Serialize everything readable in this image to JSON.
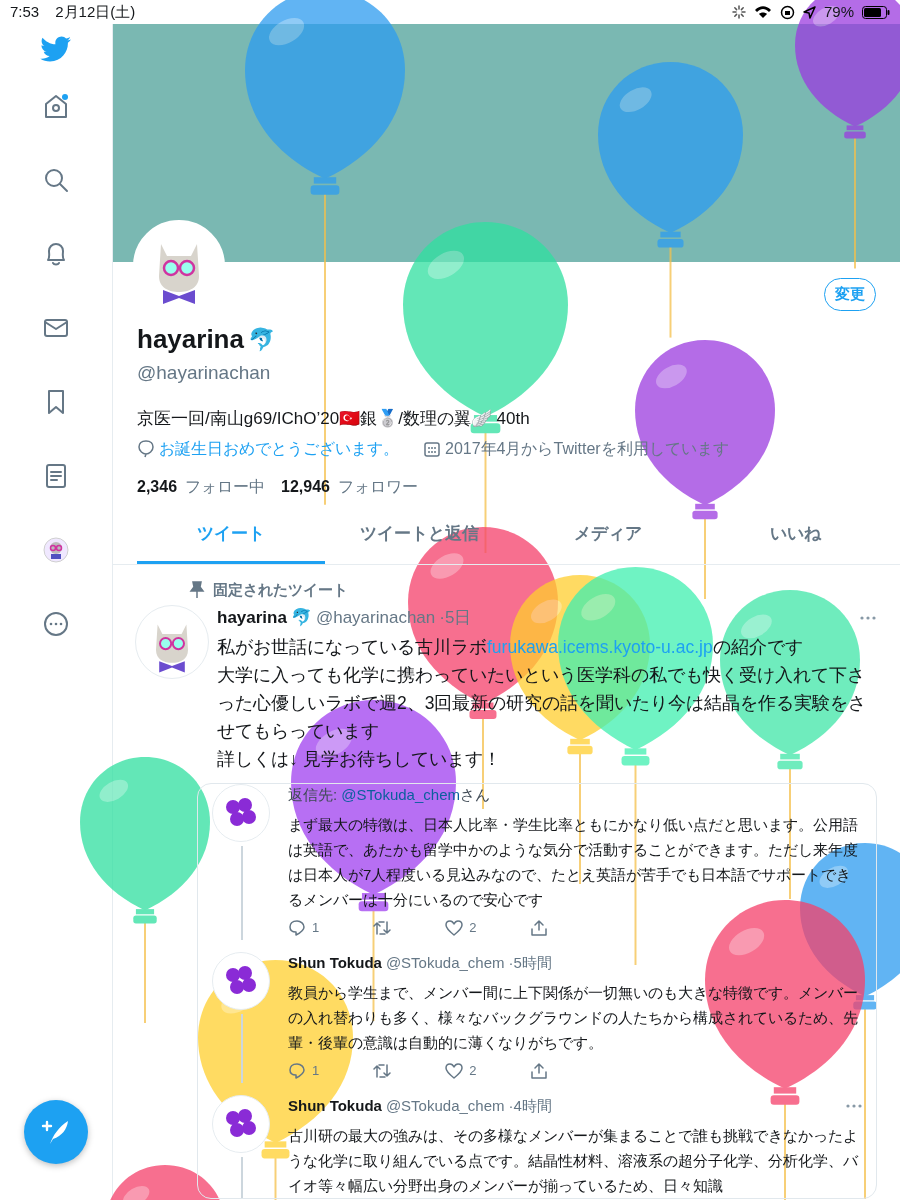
{
  "status_bar": {
    "time": "7:53",
    "date": "2月12日(土)",
    "battery": "79%"
  },
  "sidebar": {
    "items": [
      {
        "kind": "home"
      },
      {
        "kind": "search"
      },
      {
        "kind": "bell"
      },
      {
        "kind": "mail"
      },
      {
        "kind": "bookmark"
      },
      {
        "kind": "list"
      },
      {
        "kind": "avatar"
      },
      {
        "kind": "more"
      }
    ]
  },
  "profile": {
    "edit_button": "変更",
    "name": "hayarina",
    "name_emoji": "🐬",
    "handle": "@hayarinachan",
    "bio": "京医一回/南山g69/IChO’20🇹🇷銀🥈/数理の翼🪽 40th",
    "birthday": "お誕生日おめでとうございます。",
    "joined": "2017年4月からTwitterを利用しています",
    "following_count": "2,346",
    "following_label": "フォロー中",
    "followers_count": "12,946",
    "followers_label": "フォロワー"
  },
  "tabs": [
    {
      "label": "ツイート",
      "selected": true
    },
    {
      "label": "ツイートと返信",
      "selected": false
    },
    {
      "label": "メディア",
      "selected": false
    },
    {
      "label": "いいね",
      "selected": false
    }
  ],
  "pinned_label": "固定されたツイート",
  "pinned_tweet": {
    "name": "hayarina",
    "name_emoji": "🐬",
    "handle": "@hayarinachan",
    "time": "·5日",
    "text_before": "私がお世話になっている古川ラボ",
    "link": "furukawa.icems.kyoto-u.ac.jp",
    "text_after": "の紹介です",
    "more_paragraphs": [
      "大学に入っても化学に携わっていたいという医学科の私でも快く受け入れて下さった心優しいラボで週2、3回最新の研究の話を聞いたり今は結晶を作る実験をさせてもらっています",
      "詳しくは↓ 見学お待ちしています！"
    ]
  },
  "replies": [
    {
      "reply_to_prefix": "返信先: ",
      "reply_to_handle": "@STokuda_chem",
      "reply_to_suffix": "さん",
      "text": "まず最大の特徴は、日本人比率・学生比率ともにかなり低い点だと思います。公用語は英語で、あたかも留学中かのような気分で活動することができます。ただし来年度は日本人が7人程度いる見込みなので、たとえ英語が苦手でも日本語でサポートできるメンバーは十分にいるので安心です",
      "reply_count": "1",
      "like_count": "2"
    },
    {
      "name": "Shun Tokuda",
      "handle": "@STokuda_chem",
      "time": "·5時間",
      "text": "教員から学生まで、メンバー間に上下関係が一切無いのも大きな特徴です。メンバーの入れ替わりも多く、様々なバックグラウンドの人たちから構成されているため、先輩・後輩の意識は自動的に薄くなりがちです。",
      "reply_count": "1",
      "like_count": "2"
    },
    {
      "name": "Shun Tokuda",
      "handle": "@STokuda_chem",
      "time": "·4時間",
      "text": "古川研の最大の強みは、その多様なメンバーが集まることで誰も挑戦できなかったような化学に取り組んでいる点です。結晶性材料、溶液系の超分子化学、分析化学、バイオ等々幅広い分野出身のメンバーが揃っているため、日々知識"
    }
  ]
}
